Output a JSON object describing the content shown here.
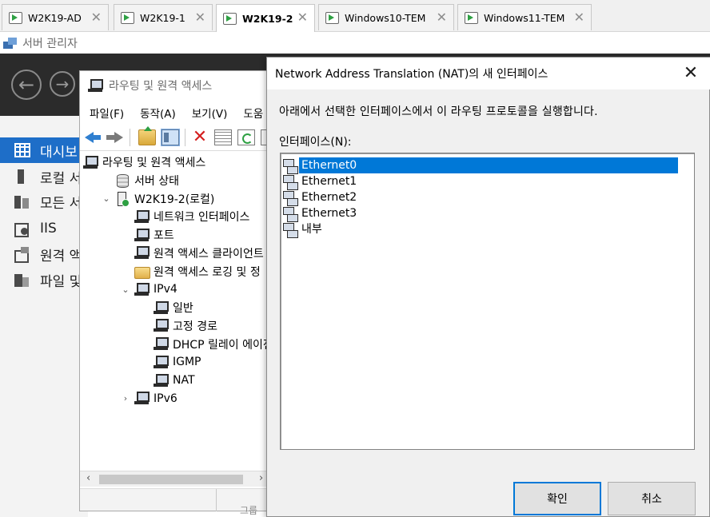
{
  "tabs": [
    {
      "label": "W2K19-AD",
      "active": false
    },
    {
      "label": "W2K19-1",
      "active": false
    },
    {
      "label": "W2K19-2",
      "active": true
    },
    {
      "label": "Windows10-TEM",
      "active": false
    },
    {
      "label": "Windows11-TEM",
      "active": false
    }
  ],
  "tab_close_glyph": "✕",
  "server_manager": {
    "title": "서버 관리자",
    "nav": [
      {
        "label": "대시보",
        "icon": "dashboard-grid-icon",
        "active": true
      },
      {
        "label": "로컬 서",
        "icon": "local-server-icon"
      },
      {
        "label": "모든 서",
        "icon": "all-servers-icon"
      },
      {
        "label": "IIS",
        "icon": "iis-icon"
      },
      {
        "label": "원격 액",
        "icon": "remote-access-icon"
      },
      {
        "label": "파일 및",
        "icon": "file-storage-icon"
      }
    ],
    "back_glyph": "←",
    "forward_glyph": "→",
    "bottom_fragment": "그룹"
  },
  "mmc": {
    "title": "라우팅 및 원격 액세스",
    "menu": [
      "파일(F)",
      "동작(A)",
      "보기(V)",
      "도움"
    ],
    "toolbar": [
      "back-icon",
      "forward-icon",
      "up-folder-icon",
      "show-hide-tree-icon",
      "delete-icon",
      "properties-icon",
      "refresh-icon",
      "export-list-icon"
    ],
    "tree": [
      {
        "label": "라우팅 및 원격 액세스",
        "icon": "network-icon",
        "level": 0,
        "expander": ""
      },
      {
        "label": "서버 상태",
        "icon": "server-status-icon",
        "level": 1,
        "expander": ""
      },
      {
        "label": "W2K19-2(로컬)",
        "icon": "server-icon",
        "level": 1,
        "expander": "⌄"
      },
      {
        "label": "네트워크 인터페이스",
        "icon": "network-icon",
        "level": 2,
        "expander": ""
      },
      {
        "label": "포트",
        "icon": "network-icon",
        "level": 2,
        "expander": ""
      },
      {
        "label": "원격 액세스 클라이언트",
        "icon": "network-icon",
        "level": 2,
        "expander": ""
      },
      {
        "label": "원격 액세스 로깅 및 정",
        "icon": "folder-icon",
        "level": 2,
        "expander": ""
      },
      {
        "label": "IPv4",
        "icon": "network-icon",
        "level": 2,
        "expander": "⌄"
      },
      {
        "label": "일반",
        "icon": "network-icon",
        "level": 3,
        "expander": ""
      },
      {
        "label": "고정 경로",
        "icon": "network-icon",
        "level": 3,
        "expander": ""
      },
      {
        "label": "DHCP 릴레이 에이전",
        "icon": "network-icon",
        "level": 3,
        "expander": ""
      },
      {
        "label": "IGMP",
        "icon": "network-icon",
        "level": 3,
        "expander": ""
      },
      {
        "label": "NAT",
        "icon": "network-icon",
        "level": 3,
        "expander": ""
      },
      {
        "label": "IPv6",
        "icon": "network-icon",
        "level": 2,
        "expander": "›"
      }
    ],
    "hscroll_left": "‹",
    "hscroll_right": "›"
  },
  "dialog": {
    "title": "Network Address Translation (NAT)의 새 인터페이스",
    "close_glyph": "✕",
    "description": "아래에서 선택한 인터페이스에서 이 라우팅 프로토콜을 실행합니다.",
    "list_label": "인터페이스(N):",
    "interfaces": [
      "Ethernet0",
      "Ethernet1",
      "Ethernet2",
      "Ethernet3",
      "내부"
    ],
    "selected_index": 0,
    "ok_label": "확인",
    "cancel_label": "취소"
  }
}
